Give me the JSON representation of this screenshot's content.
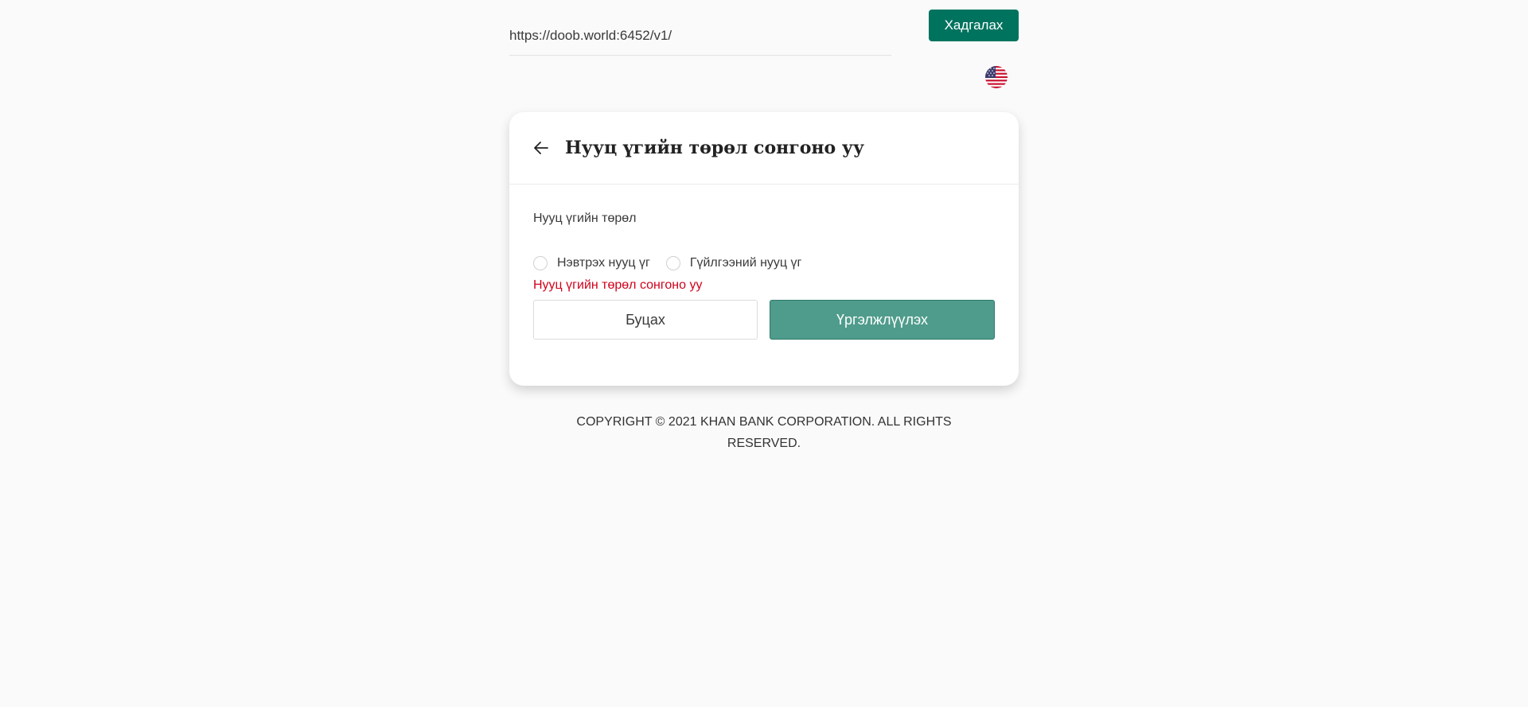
{
  "topbar": {
    "url_value": "https://doob.world:6452/v1/",
    "save_label": "Хадгалах",
    "language_icon": "us-flag-icon"
  },
  "card": {
    "title": "Нууц үгийн төрөл сонгоно уу",
    "back_icon": "arrow-left-icon",
    "field_label": "Нууц үгийн төрөл",
    "options": [
      {
        "label": "Нэвтрэх нууц үг",
        "selected": false
      },
      {
        "label": "Гүйлгээний нууц үг",
        "selected": false
      }
    ],
    "error_message": "Нууц үгийн төрөл сонгоно уу",
    "back_button_label": "Буцах",
    "continue_button_label": "Үргэлжлүүлэх"
  },
  "footer": {
    "line1": "COPYRIGHT © 2021 KHAN BANK CORPORATION. ALL RIGHTS",
    "line2": "RESERVED."
  },
  "colors": {
    "primary": "#00735f",
    "continue_button": "#4f9c8c",
    "error": "#d0021b",
    "background": "#fafafa"
  }
}
